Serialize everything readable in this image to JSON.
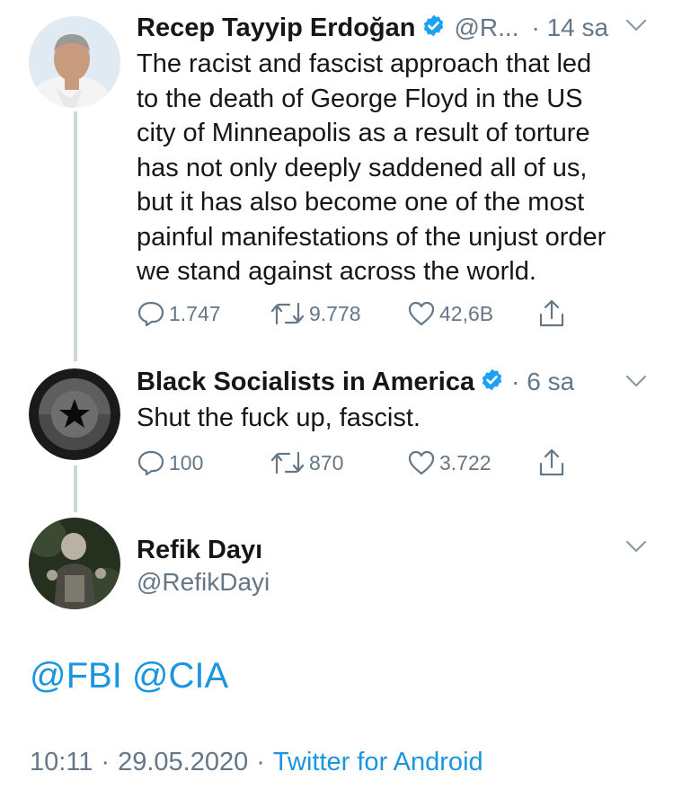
{
  "tweets": [
    {
      "author_name": "Recep Tayyip Erdoğan",
      "handle": "@R...",
      "time": "· 14 sa",
      "text_lines": [
        "The racist and fascist approach that led",
        "to the death of George Floyd in the US",
        "city of Minneapolis as a result of torture",
        "has not only deeply saddened all of us,",
        "but it has also become one of the most",
        "painful manifestations of the unjust order",
        "we stand against across the world."
      ],
      "replies": "1.747",
      "retweets": "9.778",
      "likes": "42,6B"
    },
    {
      "author_name": "Black Socialists in America",
      "time": "· 6 sa",
      "text": "Shut the fuck up, fascist.",
      "replies": "100",
      "retweets": "870",
      "likes": "3.722"
    }
  ],
  "focused": {
    "author_name": "Refik Dayı",
    "handle": "@RefikDayi",
    "mention_1": "@FBI",
    "mention_2": "@CIA",
    "time": "10:11",
    "separator": "·",
    "date": "29.05.2020",
    "client": "Twitter for Android"
  },
  "colors": {
    "text": "#14171a",
    "secondary": "#657786",
    "link": "#1b95e0",
    "verified": "#1da1f2",
    "thread_line": "#ccd6dd"
  }
}
